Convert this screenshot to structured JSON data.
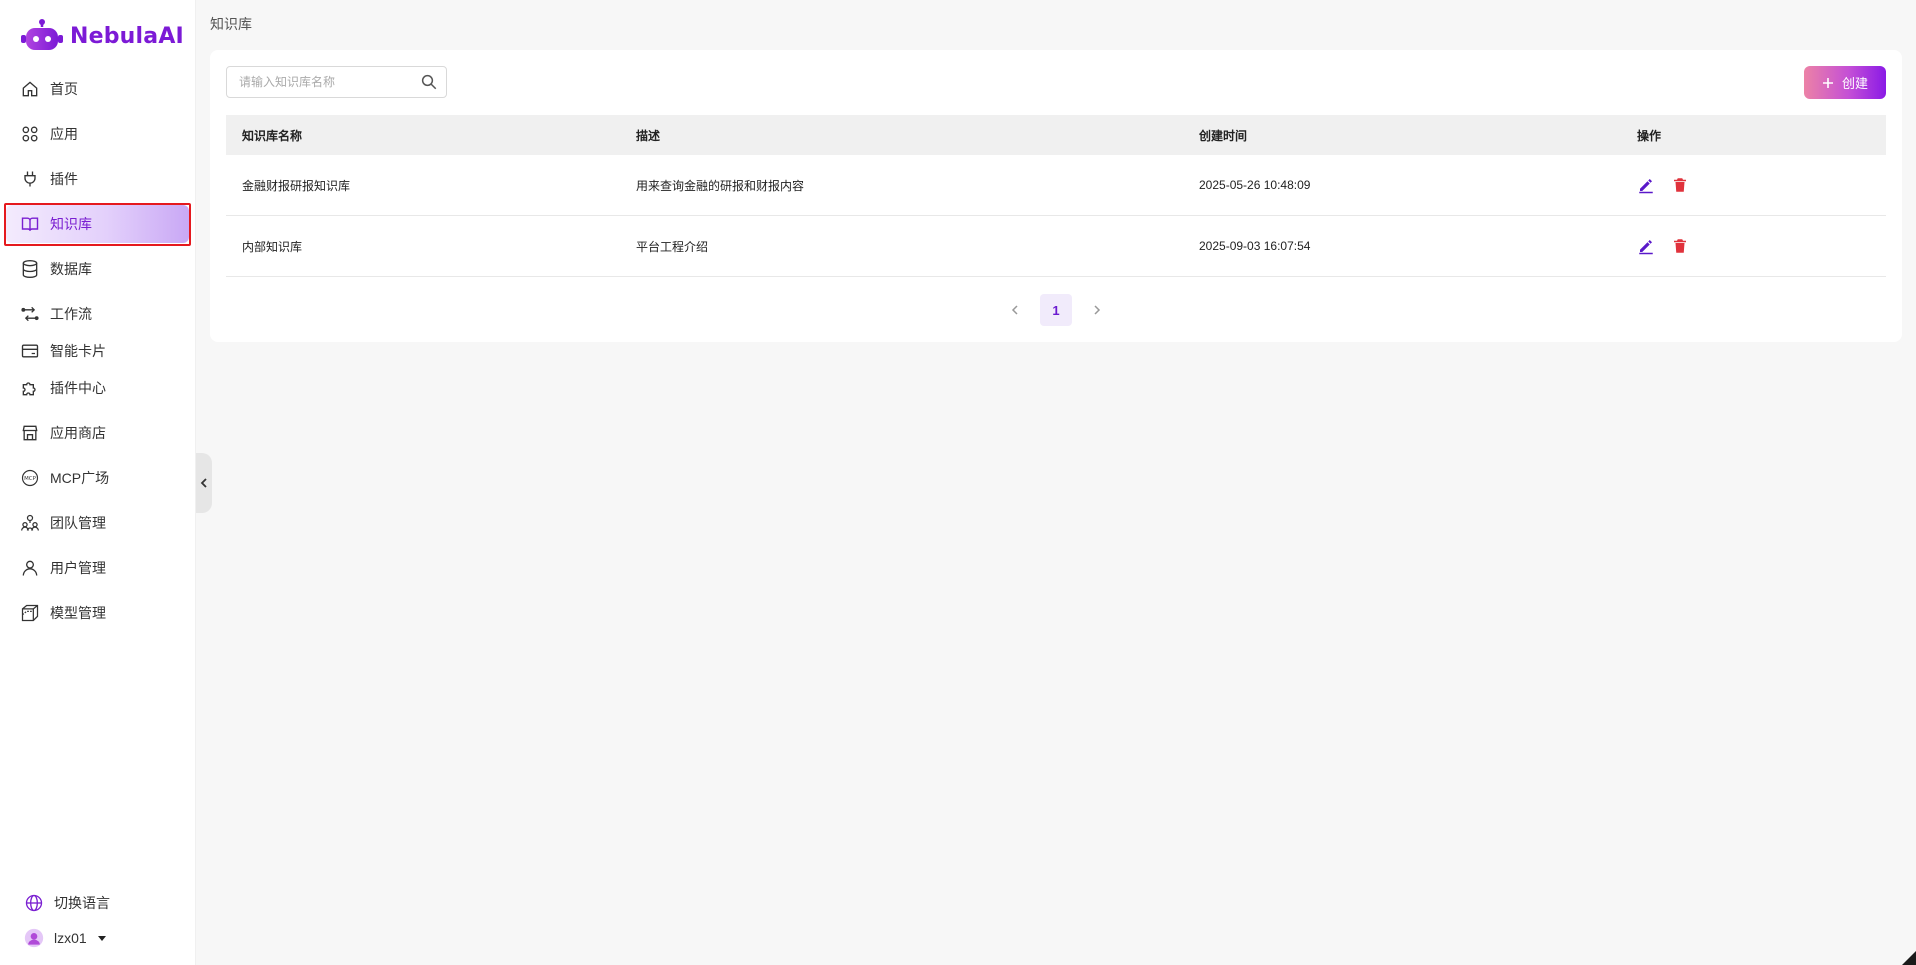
{
  "brand": {
    "name": "NebulaAI",
    "color": "#7c1ad6"
  },
  "breadcrumb": "知识库",
  "sidebar": {
    "items": [
      {
        "label": "首页",
        "icon": "home-icon"
      },
      {
        "label": "应用",
        "icon": "apps-grid-icon"
      },
      {
        "label": "插件",
        "icon": "plug-icon"
      },
      {
        "label": "知识库",
        "icon": "book-icon",
        "active": true
      },
      {
        "label": "数据库",
        "icon": "database-icon"
      },
      {
        "label": "工作流",
        "icon": "workflow-icon"
      },
      {
        "label": "智能卡片",
        "icon": "card-icon"
      },
      {
        "label": "插件中心",
        "icon": "puzzle-icon"
      },
      {
        "label": "应用商店",
        "icon": "store-icon"
      },
      {
        "label": "MCP广场",
        "icon": "mcp-icon"
      },
      {
        "label": "团队管理",
        "icon": "team-icon"
      },
      {
        "label": "用户管理",
        "icon": "user-icon"
      },
      {
        "label": "模型管理",
        "icon": "cube-icon"
      }
    ],
    "language_label": "切换语言",
    "user_name": "lzx01"
  },
  "search": {
    "placeholder": "请输入知识库名称",
    "value": ""
  },
  "create_label": "创建",
  "table": {
    "headers": [
      "知识库名称",
      "描述",
      "创建时间",
      "操作"
    ],
    "rows": [
      {
        "name": "金融财报研报知识库",
        "description": "用来查询金融的研报和财报内容",
        "created": "2025-05-26 10:48:09"
      },
      {
        "name": "内部知识库",
        "description": "平台工程介绍",
        "created": "2025-09-03 16:07:54"
      }
    ]
  },
  "pagination": {
    "current": "1"
  },
  "colors": {
    "accent": "#7a1fd1",
    "delete": "#e0323c",
    "edit": "#5a18c9"
  }
}
